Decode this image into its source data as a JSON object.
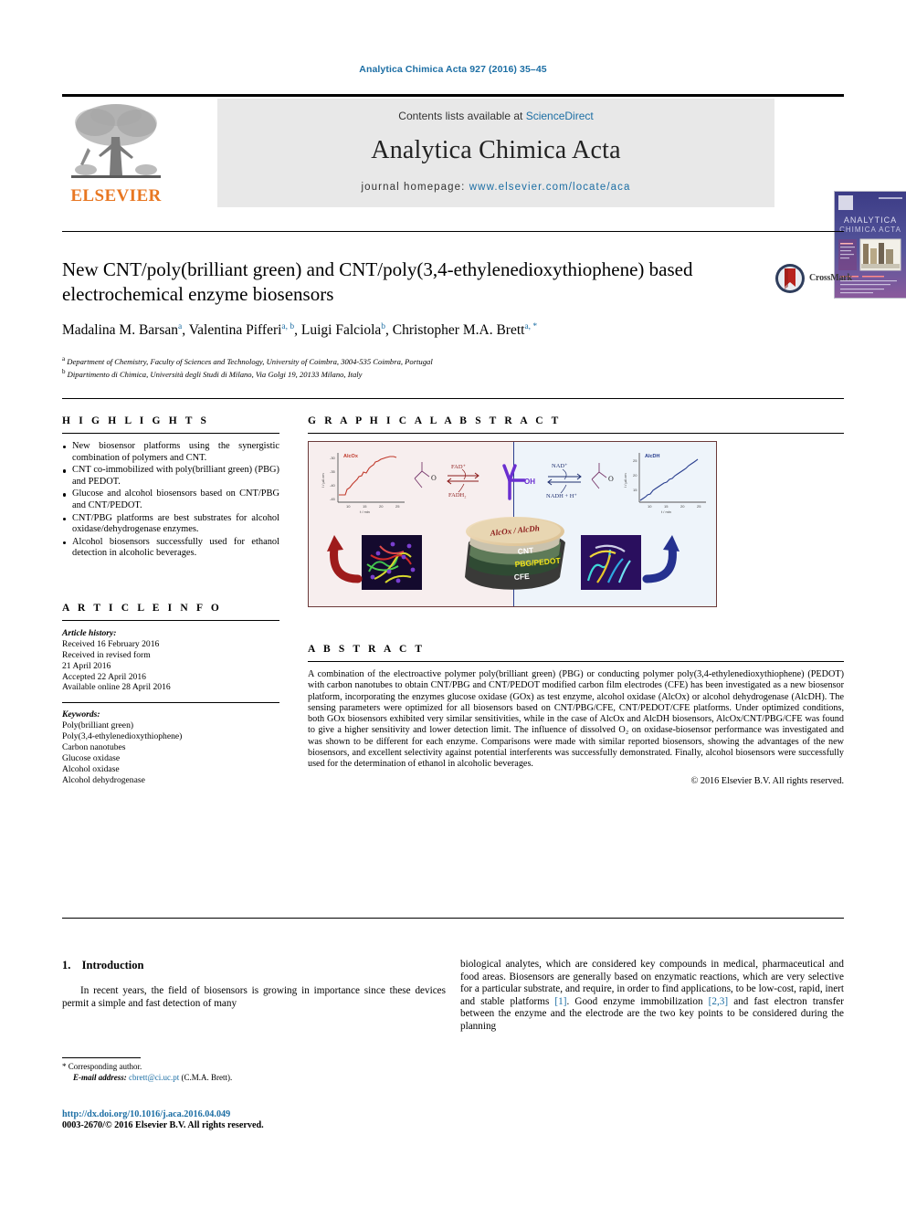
{
  "running_head": "Analytica Chimica Acta 927 (2016) 35–45",
  "masthead": {
    "contents_prefix": "Contents lists available at ",
    "contents_link": "ScienceDirect",
    "journal_title": "Analytica Chimica Acta",
    "homepage_prefix": "journal homepage: ",
    "homepage_url": "www.elsevier.com/locate/aca",
    "publisher": "ELSEVIER",
    "cover_title_line1": "ANALYTICA",
    "cover_title_line2": "CHIMICA ACTA"
  },
  "article": {
    "title": "New CNT/poly(brilliant green) and CNT/poly(3,4-ethylenedioxythiophene) based electrochemical enzyme biosensors",
    "crossmark_label": "CrossMark",
    "authors": [
      {
        "name": "Madalina M. Barsan",
        "marks": "a"
      },
      {
        "name": "Valentina Pifferi",
        "marks": "a, b"
      },
      {
        "name": "Luigi Falciola",
        "marks": "b"
      },
      {
        "name": "Christopher M.A. Brett",
        "marks": "a, *"
      }
    ],
    "affiliations": [
      {
        "mark": "a",
        "text": "Department of Chemistry, Faculty of Sciences and Technology, University of Coimbra, 3004-535 Coimbra, Portugal"
      },
      {
        "mark": "b",
        "text": "Dipartimento di Chimica, Università degli Studi di Milano, Via Golgi 19, 20133 Milano, Italy"
      }
    ]
  },
  "highlights": {
    "heading": "H I G H L I G H T S",
    "items": [
      "New biosensor platforms using the synergistic combination of polymers and CNT.",
      "CNT co-immobilized with poly(brilliant green) (PBG) and PEDOT.",
      "Glucose and alcohol biosensors based on CNT/PBG and CNT/PEDOT.",
      "CNT/PBG platforms are best substrates for alcohol oxidase/dehydrogenase enzymes.",
      "Alcohol biosensors successfully used for ethanol detection in alcoholic beverages."
    ]
  },
  "graphical_abstract": {
    "heading": "G R A P H I C A L   A B S T R A C T",
    "left_panel": {
      "curve_label": "AlcOx",
      "y_axis": "I / µA cm⁻²",
      "x_axis": "t / min",
      "y_ticks": [
        "-30",
        "-35",
        "-40",
        "-45"
      ],
      "x_ticks": [
        "10",
        "15",
        "20",
        "25"
      ],
      "cofactor_top": "FAD⁺",
      "cofactor_bottom": "FADH₂",
      "product": "O"
    },
    "right_panel": {
      "curve_label": "AlcDH",
      "y_axis": "I / µA cm⁻²",
      "x_axis": "t / min",
      "y_ticks": [
        "25",
        "20",
        "15"
      ],
      "x_ticks": [
        "10",
        "15",
        "20",
        "25"
      ],
      "cofactor_top": "NAD⁺",
      "cofactor_bottom": "NADH + H⁺",
      "product": "O"
    },
    "center": {
      "enzyme_layer": "AlcOx / AlcDh",
      "layer_cnt": "CNT",
      "layer_polymer": "PBG/PEDOT",
      "layer_electrode": "CFE",
      "analyte": "OH"
    }
  },
  "article_info": {
    "heading": "A R T I C L E   I N F O",
    "history_label": "Article history:",
    "history": [
      "Received 16 February 2016",
      "Received in revised form",
      "21 April 2016",
      "Accepted 22 April 2016",
      "Available online 28 April 2016"
    ],
    "keywords_label": "Keywords:",
    "keywords": [
      "Poly(brilliant green)",
      "Poly(3,4-ethylenedioxythiophene)",
      "Carbon nanotubes",
      "Glucose oxidase",
      "Alcohol oxidase",
      "Alcohol dehydrogenase"
    ]
  },
  "abstract": {
    "heading": "A B S T R A C T",
    "text": "A combination of the electroactive polymer poly(brilliant green) (PBG) or conducting polymer poly(3,4-ethylenedioxythiophene) (PEDOT) with carbon nanotubes to obtain CNT/PBG and CNT/PEDOT modified carbon film electrodes (CFE) has been investigated as a new biosensor platform, incorporating the enzymes glucose oxidase (GOx) as test enzyme, alcohol oxidase (AlcOx) or alcohol dehydrogenase (AlcDH). The sensing parameters were optimized for all biosensors based on CNT/PBG/CFE, CNT/PEDOT/CFE platforms. Under optimized conditions, both GOx biosensors exhibited very similar sensitivities, while in the case of AlcOx and AlcDH biosensors, AlcOx/CNT/PBG/CFE was found to give a higher sensitivity and lower detection limit. The influence of dissolved O₂ on oxidase-biosensor performance was investigated and was shown to be different for each enzyme. Comparisons were made with similar reported biosensors, showing the advantages of the new biosensors, and excellent selectivity against potential interferents was successfully demonstrated. Finally, alcohol biosensors were successfully used for the determination of ethanol in alcoholic beverages.",
    "copyright": "© 2016 Elsevier B.V. All rights reserved."
  },
  "body": {
    "section_number": "1.",
    "section_title": "Introduction",
    "left_paragraph": "In recent years, the field of biosensors is growing in importance since these devices permit a simple and fast detection of many",
    "right_paragraph_1": "biological analytes, which are considered key compounds in medical, pharmaceutical and food areas. Biosensors are generally based on enzymatic reactions, which are very selective for a particular substrate, and require, in order to find applications, to be low-cost, rapid, inert and stable platforms ",
    "right_ref_1": "[1]",
    "right_paragraph_2": ". Good enzyme immobilization ",
    "right_ref_2": "[2,3]",
    "right_paragraph_3": " and fast electron transfer between the enzyme and the electrode are the two key points to be considered during the planning"
  },
  "footer": {
    "corresponding_star": "*",
    "corresponding_label": "Corresponding author.",
    "email_label": "E-mail address:",
    "email": "cbrett@ci.uc.pt",
    "email_owner": "(C.M.A. Brett).",
    "doi": "http://dx.doi.org/10.1016/j.aca.2016.04.049",
    "issn_line": "0003-2670/© 2016 Elsevier B.V. All rights reserved."
  },
  "colors": {
    "link": "#1c6ea4",
    "elsevier_orange": "#e87722",
    "band_gray": "#e8e8e8",
    "ga_left_bg": "#f7eeee",
    "ga_right_bg": "#eef4fa",
    "alcox_red": "#c0392b",
    "alcdh_blue": "#2a3f8f"
  }
}
